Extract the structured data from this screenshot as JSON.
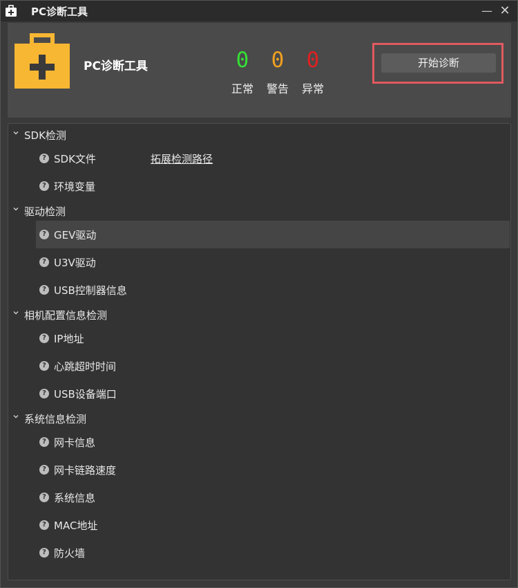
{
  "window": {
    "title": "PC诊断工具",
    "minimize": "—",
    "close": "✕"
  },
  "header": {
    "app_name": "PC诊断工具",
    "stats": [
      {
        "value": "0",
        "label": "正常",
        "color": "#35e035"
      },
      {
        "value": "0",
        "label": "警告",
        "color": "#f0a020"
      },
      {
        "value": "0",
        "label": "异常",
        "color": "#e02020"
      }
    ],
    "start_button": "开始诊断",
    "logo_color": "#f7b733"
  },
  "tree": {
    "groups": [
      {
        "label": "SDK检测",
        "items": [
          "SDK文件",
          "环境变量"
        ],
        "extra_link": "拓展检测路径"
      },
      {
        "label": "驱动检测",
        "items": [
          "GEV驱动",
          "U3V驱动",
          "USB控制器信息"
        ]
      },
      {
        "label": "相机配置信息检测",
        "items": [
          "IP地址",
          "心跳超时时间",
          "USB设备端口"
        ]
      },
      {
        "label": "系统信息检测",
        "items": [
          "网卡信息",
          "网卡链路速度",
          "系统信息",
          "MAC地址",
          "防火墙"
        ]
      }
    ],
    "status_icon": "question-icon",
    "selected_item": "GEV驱动"
  }
}
